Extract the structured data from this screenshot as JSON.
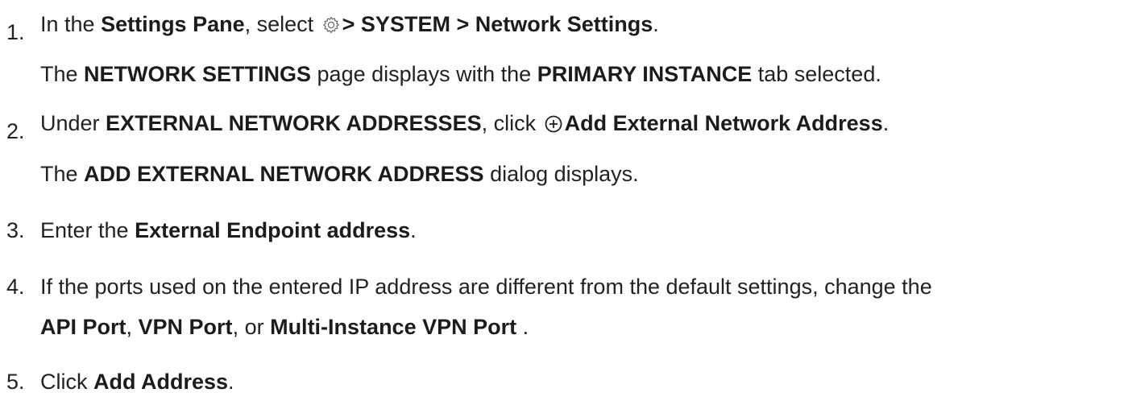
{
  "steps": [
    {
      "number": "1.",
      "text_1": "In the ",
      "bold_1": "Settings Pane",
      "text_2": ", select ",
      "icon": "gear-icon",
      "bold_2": "> SYSTEM > Network Settings",
      "text_3": ".",
      "result": {
        "text_1": "The ",
        "bold_1": "NETWORK SETTINGS",
        "text_2": " page displays with the ",
        "bold_2": "PRIMARY INSTANCE",
        "text_3": " tab selected."
      }
    },
    {
      "number": "2.",
      "text_1": "Under ",
      "bold_1": "EXTERNAL NETWORK ADDRESSES",
      "text_2": ", click ",
      "icon": "add-circle-icon",
      "bold_2": "Add External Network Address",
      "text_3": ".",
      "result": {
        "text_1": "The ",
        "bold_1": "ADD EXTERNAL NETWORK ADDRESS",
        "text_2": " dialog displays."
      }
    },
    {
      "number": "3.",
      "text_1": "Enter the ",
      "bold_1": "External Endpoint address",
      "text_2": "."
    },
    {
      "number": "4.",
      "text_1": "If the ports used on the entered IP address are different from the default settings, change the",
      "bold_1": "API Port",
      "text_2": ", ",
      "bold_2": "VPN Port",
      "text_3": ", or ",
      "bold_3": "Multi-Instance VPN Port",
      "text_4": " ."
    },
    {
      "number": "5.",
      "text_1": "Click ",
      "bold_1": "Add Address",
      "text_2": "."
    }
  ]
}
